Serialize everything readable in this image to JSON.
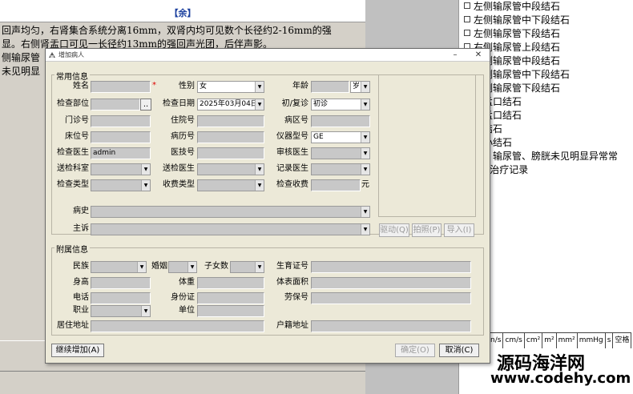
{
  "document": {
    "section_title": "【余】",
    "lines": [
      "回声均匀，右肾集合系统分离16mm，双肾内均可见数个长径约2-16mm的强",
      "显。右侧肾盂口可见一长径约13mm的强回声光团，后伴声影。",
      "侧输尿管",
      "未见明显"
    ]
  },
  "side_list": {
    "items": [
      "左侧输尿管中段结石",
      "左侧输尿管中下段结石",
      "左侧输尿管下段结石",
      "右侧输尿管上段结石",
      "右侧输尿管中段结石",
      "右侧输尿管中下段结石",
      "右侧输尿管下段结石",
      "左肾盂口结石",
      "右肾盂口结石",
      "膀胱结石",
      "肾小结石",
      "肾、输尿管、膀胱未见明显异常",
      "ESWL治疗记录"
    ],
    "visible_texts": [
      "左侧输尿管中段结石",
      "左侧输尿管中下段结石",
      "左侧输尿管下段结石",
      "右侧输尿管上段结石",
      "右侧输尿管中段结石",
      "右侧输尿管中下段结石",
      "右侧输尿管下段结石",
      "肾盂口结石",
      "肾盂口结石",
      "胱结石",
      "肾小结石",
      "肾、输尿管、膀胱未见明显异常常",
      "WL治疗记录"
    ]
  },
  "units": [
    "n/s",
    "cm/s",
    "cm²",
    "m²",
    "mm²",
    "mmHg",
    "s",
    "空格"
  ],
  "watermark": {
    "line1": "源码海洋网",
    "line2": "www.codehy.com"
  },
  "dialog": {
    "title": "增加病人",
    "common_group": "常用信息",
    "extra_group": "附属信息",
    "labels": {
      "name": "姓名",
      "gender": "性别",
      "age": "年龄",
      "exam_part": "检查部位",
      "exam_date": "检查日期",
      "visit_type": "初/复诊",
      "outpatient_no": "门诊号",
      "inpatient_no": "住院号",
      "ward_no": "病区号",
      "bed_no": "床位号",
      "record_no": "病历号",
      "device_model": "仪器型号",
      "exam_doctor": "检查医生",
      "tech_no": "医技号",
      "review_doctor": "审核医生",
      "sending_dept": "送检科室",
      "sending_doctor": "送检医生",
      "record_doctor": "记录医生",
      "exam_type": "检查类型",
      "charge_type": "收费类型",
      "exam_fee": "检查收费",
      "history": "病史",
      "complaint": "主诉",
      "ethnicity": "民族",
      "marriage": "婚姻",
      "children": "子女数",
      "birth_cert": "生育证号",
      "height": "身高",
      "weight": "体重",
      "bsa": "体表面积",
      "phone": "电话",
      "id_card": "身份证",
      "insurance_no": "劳保号",
      "job": "职业",
      "employer": "单位",
      "address": "居住地址",
      "household_address": "户籍地址"
    },
    "values": {
      "gender": "女",
      "age_unit": "岁",
      "exam_date": "2025年03月04日",
      "visit_type": "初诊",
      "device_model": "GE",
      "exam_doctor": "admin",
      "exam_part_button": "..",
      "fee_unit": "元",
      "required_mark": "*"
    },
    "photo_buttons": [
      "驱动(Q)",
      "拍照(P)",
      "导入(I)"
    ],
    "buttons": {
      "continue_add": "继续增加(A)",
      "ok": "确定(O)",
      "cancel": "取消(C)"
    }
  }
}
